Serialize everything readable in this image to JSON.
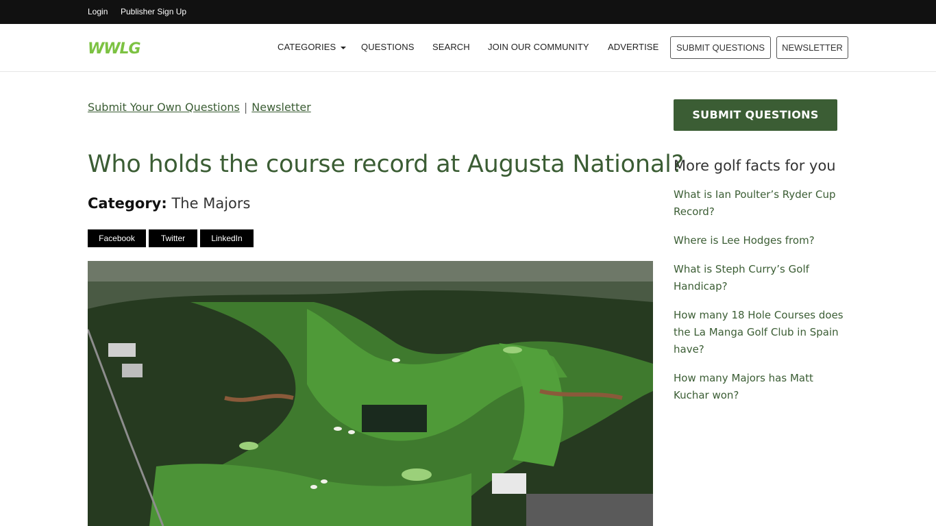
{
  "topbar": {
    "login": "Login",
    "publisher_signup": "Publisher Sign Up"
  },
  "navbar": {
    "logo_text": "WWLG",
    "categories": "CATEGORIES",
    "questions": "QUESTIONS",
    "search": "SEARCH",
    "join": "JOIN OUR COMMUNITY",
    "advertise": "ADVERTISE",
    "submit_questions": "SUBMIT QUESTIONS",
    "newsletter": "NEWSLETTER"
  },
  "sublinks": {
    "submit_own": "Submit Your Own Questions",
    "separator": "|",
    "newsletter": "Newsletter"
  },
  "article": {
    "title": "Who holds the course record at Augusta National?",
    "category_label": "Category:",
    "category_value": "The Majors",
    "share": {
      "facebook": "Facebook",
      "twitter": "Twitter",
      "linkedin": "LinkedIn"
    }
  },
  "sidebar": {
    "submit_button": "SUBMIT QUESTIONS",
    "heading": "More golf facts for you",
    "items": [
      "What is Ian Poulter’s Ryder Cup Record?",
      "Where is Lee Hodges from?",
      "What is Steph Curry’s Golf Handicap?",
      "How many 18 Hole Courses does the La Manga Golf Club in Spain have?",
      "How many Majors has Matt Kuchar won?"
    ]
  },
  "colors": {
    "brand_green": "#3b5d34",
    "logo_green": "#7cc242",
    "topbar_bg": "#111111"
  }
}
